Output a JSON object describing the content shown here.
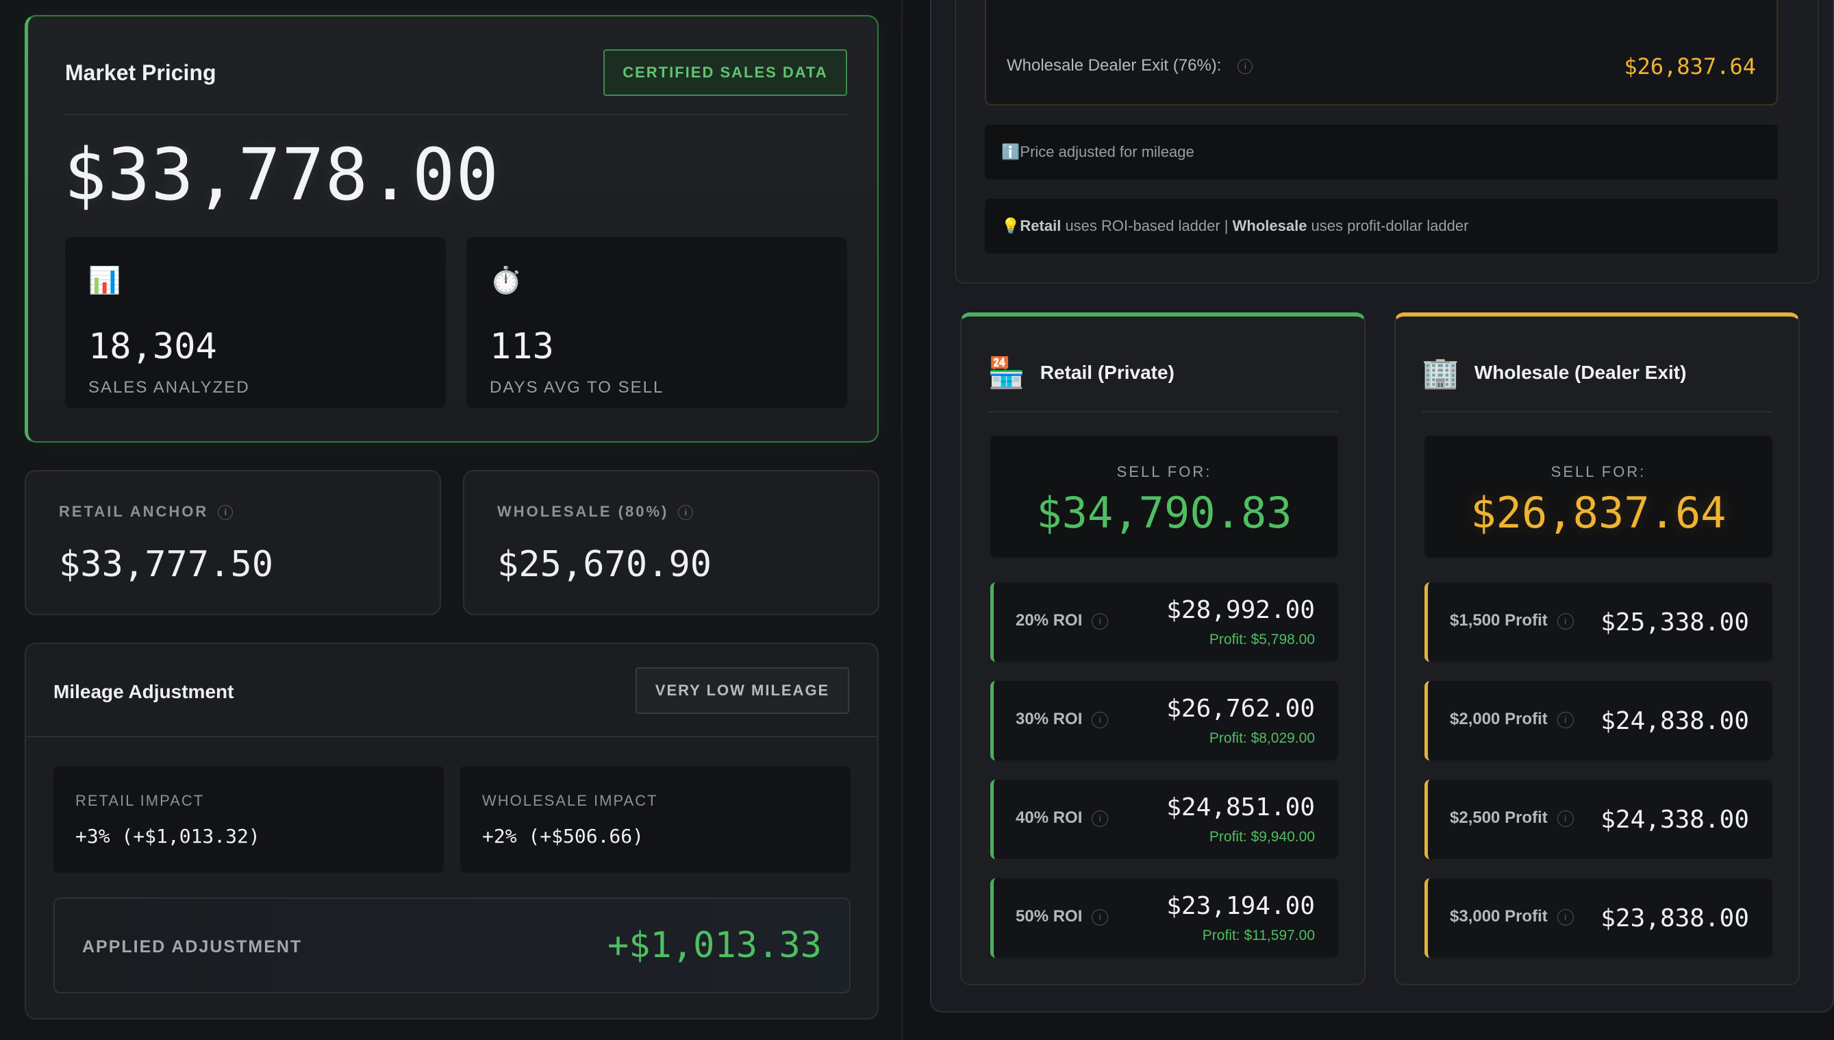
{
  "market": {
    "title": "Market Pricing",
    "badge": "CERTIFIED SALES DATA",
    "price": "$33,778.00",
    "stats": [
      {
        "icon": "📊",
        "icon_name": "bar-chart-icon",
        "value": "18,304",
        "label": "SALES ANALYZED"
      },
      {
        "icon": "⏱️",
        "icon_name": "stopwatch-icon",
        "value": "113",
        "label": "DAYS AVG TO SELL"
      }
    ]
  },
  "anchors": {
    "retail": {
      "label": "RETAIL ANCHOR",
      "value": "$33,777.50"
    },
    "wholesale": {
      "label": "WHOLESALE (80%)",
      "value": "$25,670.90"
    }
  },
  "mileage": {
    "title": "Mileage Adjustment",
    "badge": "VERY LOW MILEAGE",
    "retail_impact": {
      "label": "RETAIL IMPACT",
      "value": "+3% (+$1,013.32)"
    },
    "wholesale_impact": {
      "label": "WHOLESALE IMPACT",
      "value": "+2% (+$506.66)"
    },
    "applied": {
      "label": "APPLIED ADJUSTMENT",
      "value": "+$1,013.33"
    }
  },
  "summary": {
    "exit_label": "Wholesale Dealer Exit (76%):",
    "exit_value": "$26,837.64",
    "note_icon": "ℹ️",
    "note": "Price adjusted for mileage",
    "tip_icon": "💡",
    "tip_retail": "Retail",
    "tip_retail_text": " uses ROI-based ladder | ",
    "tip_wholesale": "Wholesale",
    "tip_wholesale_text": " uses profit-dollar ladder"
  },
  "retail": {
    "icon": "🏪",
    "title": "Retail (Private)",
    "sell_label": "SELL FOR:",
    "sell_value": "$34,790.83",
    "rungs": [
      {
        "label": "20% ROI",
        "price": "$28,992.00",
        "profit": "Profit: $5,798.00"
      },
      {
        "label": "30% ROI",
        "price": "$26,762.00",
        "profit": "Profit: $8,029.00"
      },
      {
        "label": "40% ROI",
        "price": "$24,851.00",
        "profit": "Profit: $9,940.00"
      },
      {
        "label": "50% ROI",
        "price": "$23,194.00",
        "profit": "Profit: $11,597.00"
      }
    ]
  },
  "wholesale": {
    "icon": "🏢",
    "title": "Wholesale (Dealer Exit)",
    "sell_label": "SELL FOR:",
    "sell_value": "$26,837.64",
    "rungs": [
      {
        "label": "$1,500 Profit",
        "price": "$25,338.00"
      },
      {
        "label": "$2,000 Profit",
        "price": "$24,838.00"
      },
      {
        "label": "$2,500 Profit",
        "price": "$24,338.00"
      },
      {
        "label": "$3,000 Profit",
        "price": "$23,838.00"
      }
    ]
  },
  "colors": {
    "green": "#4fbf62",
    "gold": "#f0b432",
    "background": "#131417"
  }
}
